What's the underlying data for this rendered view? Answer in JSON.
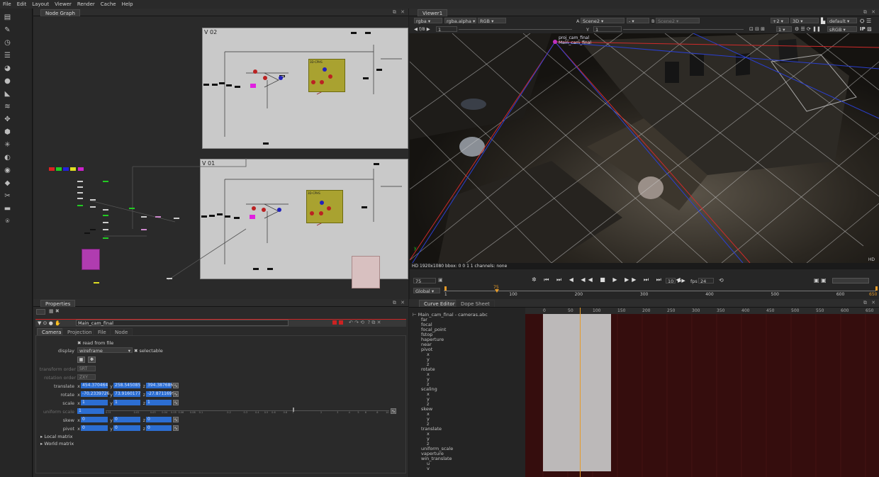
{
  "menu": [
    "File",
    "Edit",
    "Layout",
    "Viewer",
    "Render",
    "Cache",
    "Help"
  ],
  "node_graph": {
    "tab": "Node Graph",
    "backdrop_top": "V 02",
    "backdrop_bottom": "V 01",
    "group_label_top": "3D-CPHS",
    "group_label_bottom": "3D-CPHS"
  },
  "properties": {
    "tab": "Properties",
    "node_name": "Main_cam_final",
    "tabs": [
      "Camera",
      "Projection",
      "File",
      "Node"
    ],
    "read_from_file": "read from file",
    "display_label": "display",
    "display_value": "wireframe",
    "selectable": "selectable",
    "transform_order_label": "transform order",
    "transform_order_value": "SRT",
    "rotation_order_label": "rotation order",
    "rotation_order_value": "ZXY",
    "translate_label": "translate",
    "translate": {
      "x": "454.370464",
      "y": "258.545085",
      "z": "394.387686"
    },
    "rotate_label": "rotate",
    "rotate": {
      "x": "-70.2339726",
      "y": "73.9160177",
      "z": "-27.8711699"
    },
    "scale_label": "scale",
    "scale": {
      "x": "1",
      "y": "1",
      "z": "1"
    },
    "uniform_scale_label": "uniform scale",
    "uniform_scale": "1",
    "scale_ticks": [
      "0.01",
      "0.02",
      "0.03",
      "0.04",
      "0.05",
      "0.06",
      "0.08",
      "0.1",
      "0.2",
      "0.3",
      "0.4",
      "0.5",
      "0.6",
      "0.8",
      "1",
      "2",
      "3",
      "4",
      "5",
      "6",
      "8",
      "10"
    ],
    "skew_label": "skew",
    "skew": {
      "x": "0",
      "y": "0",
      "z": "0"
    },
    "pivot_label": "pivot",
    "pivot": {
      "x": "0",
      "y": "0",
      "z": "0"
    },
    "local_matrix": "Local matrix",
    "world_matrix": "World matrix"
  },
  "viewer": {
    "tab": "Viewer1",
    "channels": "rgba",
    "alpha": "rgba.alpha",
    "color": "RGB",
    "input_a_label": "A",
    "input_a": "Scene2",
    "dash": "-",
    "input_b_label": "B",
    "input_b": "Scene2",
    "gain_label": "f/8",
    "gain_value": "1",
    "y_label": "Y",
    "y_value": "1",
    "zoom": "+2",
    "view_mode": "3D",
    "lut": "default",
    "colorspace": "sRGB",
    "frame_one": "1",
    "cam_label_1": "proj_cam_final",
    "cam_label_2": "Main_cam_final",
    "status": "HD 1920x1080 bbox: 0 0 1 1 channels: none",
    "format_tag": "HD",
    "axis_y": "y",
    "frame": "75",
    "frame_mode": "Global",
    "step": "10",
    "fps_label": "fps",
    "fps": "24",
    "timeline_ticks": [
      "1",
      "100",
      "200",
      "300",
      "400",
      "500",
      "600"
    ],
    "timeline_end": "650",
    "playhead_label": "75"
  },
  "curve_editor": {
    "tabs": [
      "Curve Editor",
      "Dope Sheet"
    ],
    "ticks": [
      "0",
      "50",
      "100",
      "150",
      "200",
      "250",
      "300",
      "350",
      "400",
      "450",
      "500",
      "550",
      "600",
      "650"
    ],
    "tree_root": "Main_cam_final - cameras.abc",
    "tree": [
      "far",
      "focal",
      "focal_point",
      "fstop",
      "haperture",
      "near",
      "pivot",
      "x",
      "y",
      "z",
      "rotate",
      "x",
      "y",
      "z",
      "scaling",
      "x",
      "y",
      "z",
      "skew",
      "x",
      "y",
      "z",
      "translate",
      "x",
      "y",
      "z",
      "uniform_scale",
      "vaperture",
      "win_translate",
      "u",
      "v"
    ]
  }
}
